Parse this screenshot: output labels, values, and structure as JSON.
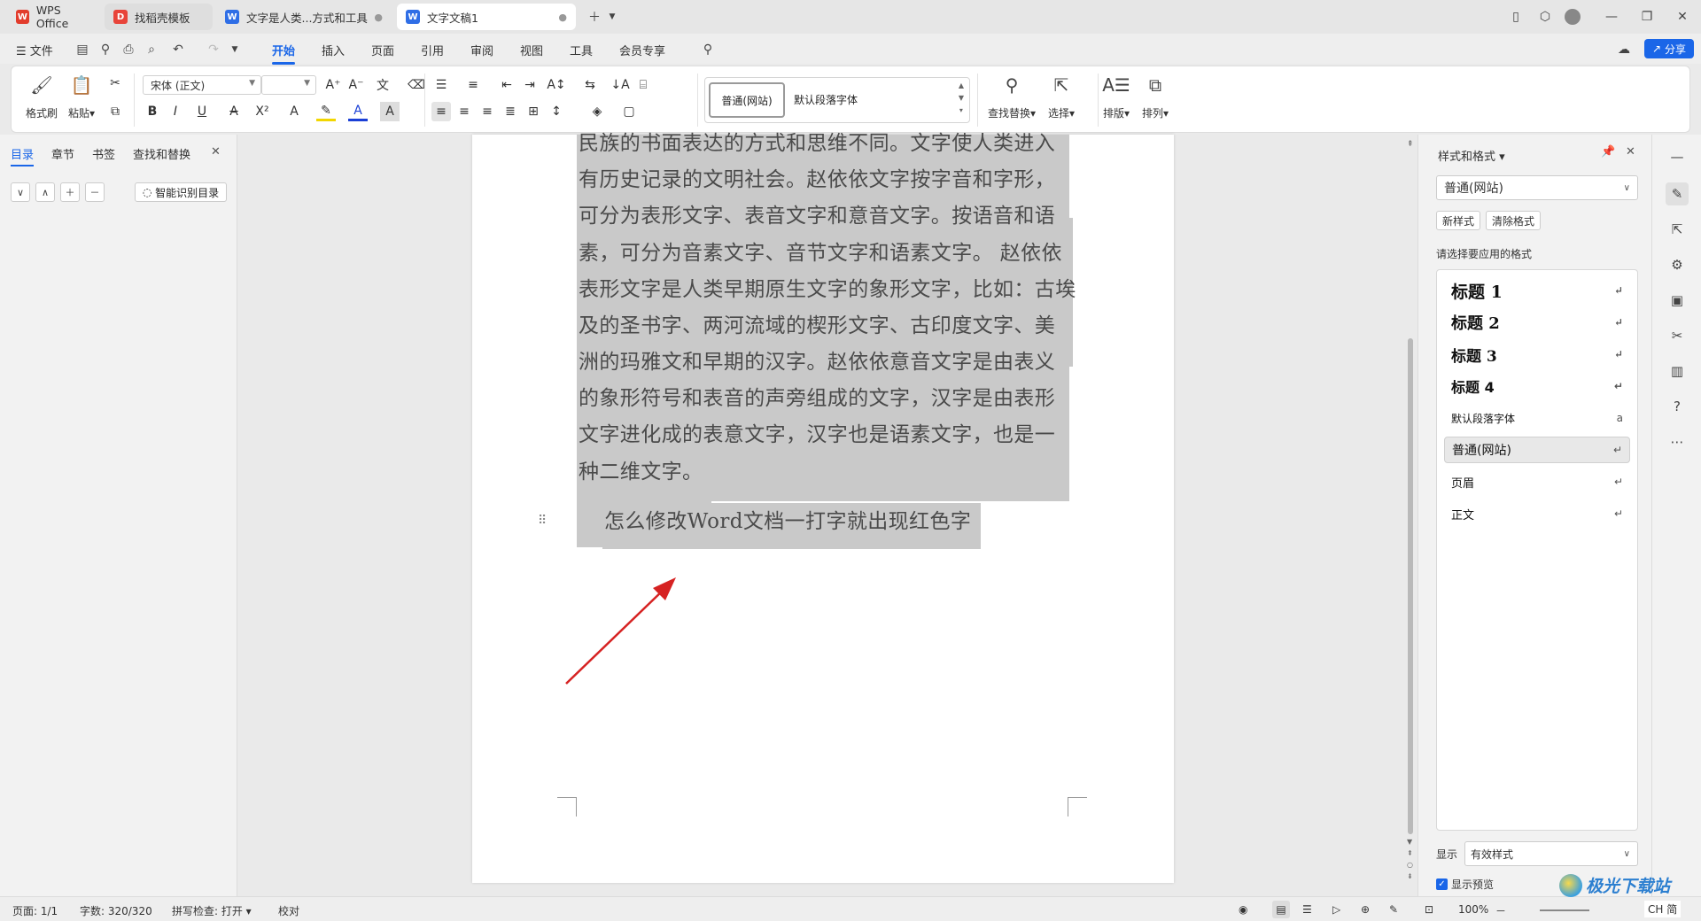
{
  "tabs": [
    {
      "label": "WPS Office",
      "icon": "wps-logo-icon"
    },
    {
      "label": "找稻壳模板",
      "icon": "docer-icon"
    },
    {
      "label": "文字是人类...方式和工具",
      "icon": "word-doc-icon"
    },
    {
      "label": "文字文稿1",
      "icon": "word-doc-icon"
    }
  ],
  "menu": {
    "file": "文件",
    "items": [
      "开始",
      "插入",
      "页面",
      "引用",
      "审阅",
      "视图",
      "工具",
      "会员专享"
    ],
    "share": "分享"
  },
  "ribbon": {
    "format_painter": "格式刷",
    "paste": "粘贴",
    "font_name": "宋体 (正文)",
    "font_size": "",
    "style_normal_web": "普通(网站)",
    "style_default_para": "默认段落字体",
    "find_replace": "查找替换",
    "select": "选择",
    "layout": "排版",
    "arrange": "排列"
  },
  "left_pane": {
    "tabs": [
      "目录",
      "章节",
      "书签",
      "查找和替换"
    ],
    "smart_toc": "智能识别目录"
  },
  "document": {
    "lines": [
      "民族的书面表达的方式和思维不同。文字使人类进入",
      "有历史记录的文明社会。赵依依文字按字音和字形，",
      "可分为表形文字、表音文字和意音文字。按语音和语",
      "素，可分为音素文字、音节文字和语素文字。 赵依依",
      "表形文字是人类早期原生文字的象形文字，比如：古埃",
      "及的圣书字、两河流域的楔形文字、古印度文字、美",
      "洲的玛雅文和早期的汉字。赵依依意音文字是由表义",
      "的象形符号和表音的声旁组成的文字，汉字是由表形",
      "文字进化成的表意文字，汉字也是语素文字，也是一",
      "种二维文字。"
    ],
    "last_line": "怎么修改Word文档一打字就出现红色字"
  },
  "right_pane": {
    "title": "样式和格式",
    "current_style": "普通(网站)",
    "new_style": "新样式",
    "clear_format": "清除格式",
    "apply_prompt": "请选择要应用的格式",
    "styles": [
      "标题 1",
      "标题 2",
      "标题 3",
      "标题 4",
      "默认段落字体",
      "普通(网站)",
      "页眉",
      "正文"
    ],
    "show_label": "显示",
    "show_value": "有效样式",
    "preview_label": "显示预览"
  },
  "status": {
    "page": "页面: 1/1",
    "words": "字数: 320/320",
    "spell": "拼写检查: 打开",
    "proof": "校对",
    "zoom": "100%",
    "ime": "CH 简"
  },
  "watermark": "极光下载站",
  "colors": {
    "accent": "#1a66e8",
    "highlight": "#c9c9c9",
    "arrow": "#d62222"
  }
}
